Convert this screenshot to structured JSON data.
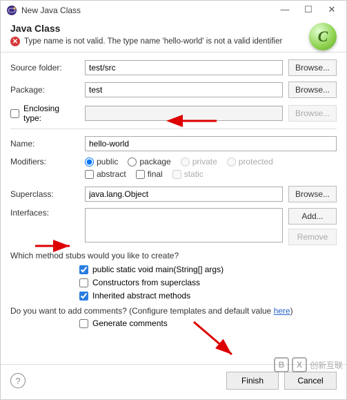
{
  "window": {
    "title": "New Java Class"
  },
  "header": {
    "title": "Java Class",
    "error": "Type name is not valid. The type name 'hello-world' is not a valid identifier"
  },
  "form": {
    "source_folder_label": "Source folder:",
    "source_folder_value": "test/src",
    "browse_label": "Browse...",
    "package_label": "Package:",
    "package_value": "test",
    "enclosing_label": "Enclosing type:",
    "enclosing_value": "",
    "name_label": "Name:",
    "name_value": "hello-world",
    "modifiers_label": "Modifiers:",
    "mod_public": "public",
    "mod_package": "package",
    "mod_private": "private",
    "mod_protected": "protected",
    "mod_abstract": "abstract",
    "mod_final": "final",
    "mod_static": "static",
    "superclass_label": "Superclass:",
    "superclass_value": "java.lang.Object",
    "interfaces_label": "Interfaces:",
    "add_label": "Add...",
    "remove_label": "Remove",
    "stubs_heading": "Which method stubs would you like to create?",
    "stub_main": "public static void main(String[] args)",
    "stub_super": "Constructors from superclass",
    "stub_abstract": "Inherited abstract methods",
    "comments_q_prefix": "Do you want to add comments? (Configure templates and default value ",
    "comments_q_link": "here",
    "comments_q_suffix": ")",
    "gen_comments": "Generate comments"
  },
  "footer": {
    "finish": "Finish",
    "cancel": "Cancel",
    "help": "?"
  },
  "watermark": {
    "b": "B",
    "x": "X",
    "text": "创新互联"
  }
}
